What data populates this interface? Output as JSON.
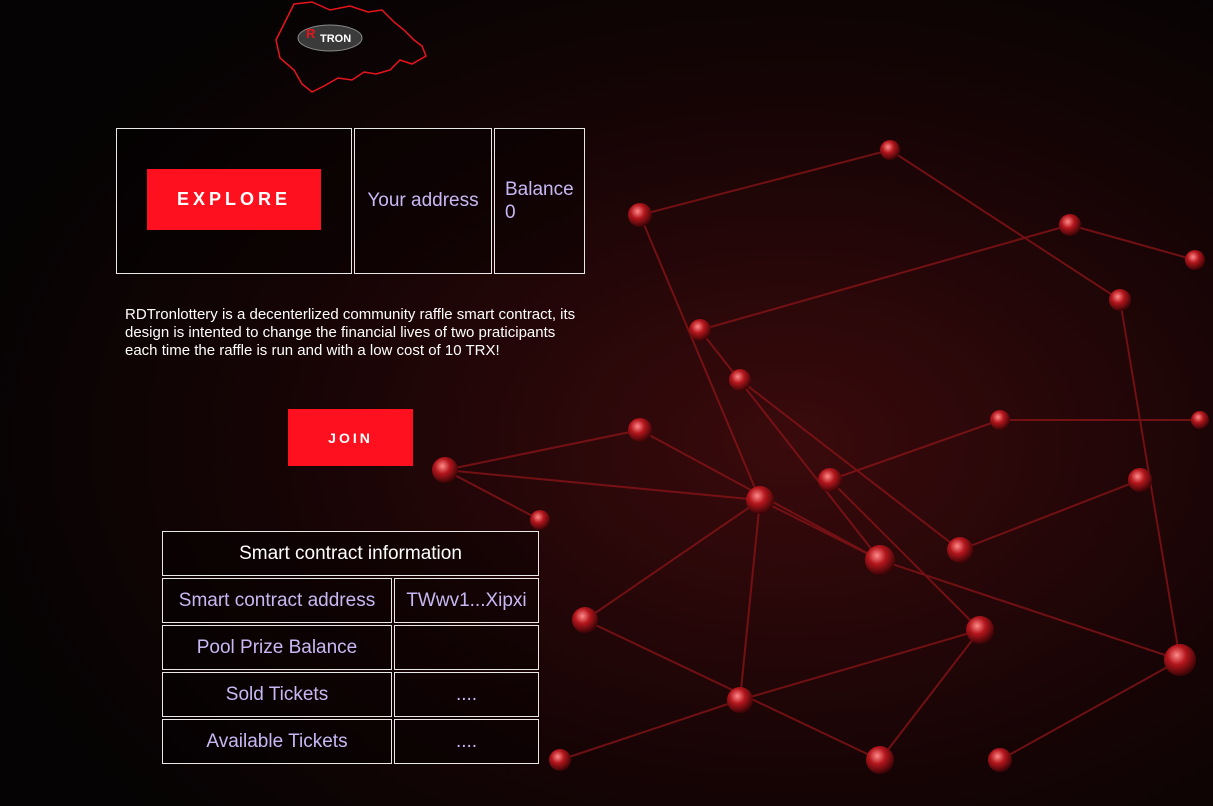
{
  "logo": {
    "name": "RD TRON lottery logo",
    "text": "TRON"
  },
  "buttons": {
    "explore_label": "EXPLORE",
    "join_label": "JOIN"
  },
  "account": {
    "address_label": "Your address",
    "balance_label": "Balance",
    "balance_value": "0"
  },
  "description": "RDTronlottery is a decenterlized community raffle smart contract, its design is intented to change the financial lives of two praticipants each time the raffle is run and with a low cost of 10 TRX!",
  "contract_info": {
    "title": "Smart contract information",
    "rows": [
      {
        "label": "Smart contract address",
        "value": "TWwv1...Xipxi"
      },
      {
        "label": "Pool Prize Balance",
        "value": ""
      },
      {
        "label": "Sold Tickets",
        "value": "...."
      },
      {
        "label": "Available Tickets",
        "value": "...."
      }
    ]
  },
  "colors": {
    "accent": "#ff101f",
    "cell_text": "#c7b8f4",
    "border": "#e8e8e8",
    "background": "#050303"
  }
}
